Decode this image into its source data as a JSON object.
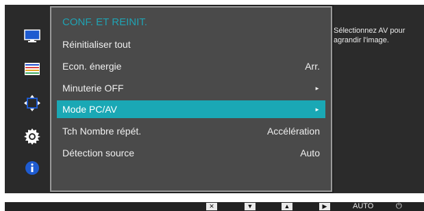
{
  "menu": {
    "title": "CONF. ET REINIT.",
    "items": [
      {
        "label": "Réinitialiser tout",
        "value": "",
        "arrow": ""
      },
      {
        "label": "Econ. énergie",
        "value": "Arr.",
        "arrow": ""
      },
      {
        "label": "Minuterie OFF",
        "value": "",
        "arrow": "►"
      },
      {
        "label": "Mode PC/AV",
        "value": "",
        "arrow": "►"
      },
      {
        "label": "Tch Nombre répét.",
        "value": "Accélération",
        "arrow": ""
      },
      {
        "label": "Détection source",
        "value": "Auto",
        "arrow": ""
      }
    ]
  },
  "help": {
    "text": "Sélectionnez AV pour\nagrandir l'image."
  },
  "sidebar": {
    "icons": [
      "monitor-icon",
      "color-bars-icon",
      "resize-icon",
      "gear-icon",
      "info-icon"
    ]
  },
  "bottom_bar": {
    "buttons": [
      {
        "icon": "close-icon",
        "glyph": "✕"
      },
      {
        "icon": "down-arrow-icon",
        "glyph": "▼"
      },
      {
        "icon": "up-arrow-icon",
        "glyph": "▲"
      },
      {
        "icon": "play-icon",
        "glyph": "▶"
      }
    ],
    "auto_label": "AUTO",
    "power_glyph": "⏻"
  },
  "colors": {
    "accent": "#1aa8b5",
    "title": "#1fa3b4"
  }
}
